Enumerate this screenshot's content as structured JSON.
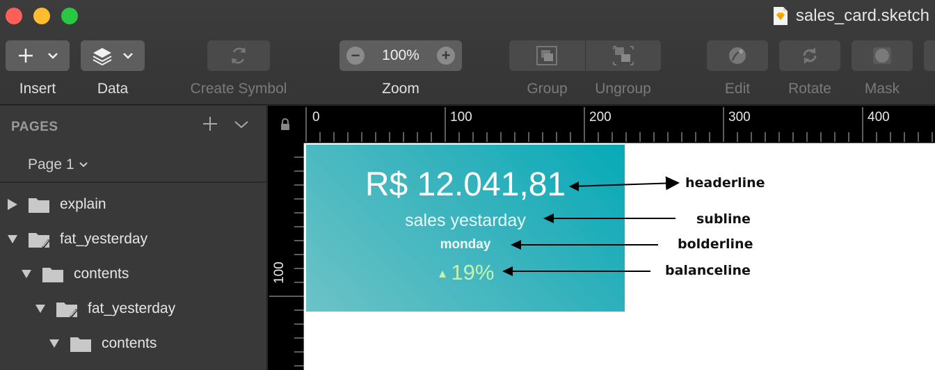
{
  "window": {
    "title": "sales_card.sketch"
  },
  "toolbar": {
    "insert": {
      "label": "Insert"
    },
    "data": {
      "label": "Data"
    },
    "create_symbol": {
      "label": "Create Symbol"
    },
    "zoom": {
      "label": "Zoom",
      "value": "100%"
    },
    "group": {
      "label": "Group"
    },
    "ungroup": {
      "label": "Ungroup"
    },
    "edit": {
      "label": "Edit"
    },
    "rotate": {
      "label": "Rotate"
    },
    "mask": {
      "label": "Mask"
    }
  },
  "sidebar": {
    "pages_title": "PAGES",
    "current_page": "Page 1",
    "layers": [
      {
        "label": "explain",
        "expanded": false
      },
      {
        "label": "fat_yesterday",
        "expanded": true
      },
      {
        "label": "contents",
        "expanded": true
      },
      {
        "label": "fat_yesterday",
        "expanded": true
      },
      {
        "label": "contents",
        "expanded": true
      }
    ]
  },
  "rulers": {
    "horizontal": [
      "0",
      "100",
      "200",
      "300",
      "400"
    ],
    "vertical": [
      "100"
    ]
  },
  "card": {
    "headline": "R$ 12.041,81",
    "subline": "sales yestarday",
    "bold": "monday",
    "balance_arrow": "▲",
    "balance": "19%"
  },
  "annotations": {
    "headerline": "headerline",
    "subline": "subline",
    "bolderline": "bolderline",
    "balanceline": "balanceline"
  },
  "colors": {
    "card_gradient_start": "#05aab7",
    "card_gradient_end": "#6cc3c6",
    "balance_positive": "#c6f2ae"
  }
}
